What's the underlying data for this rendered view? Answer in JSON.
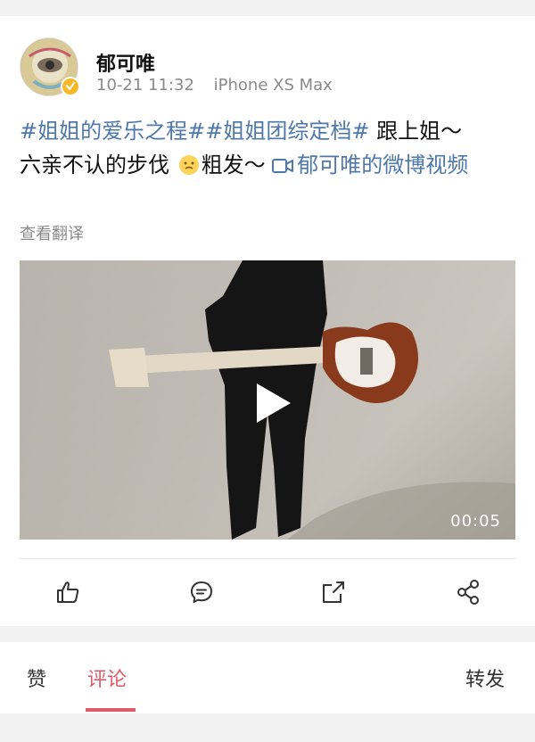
{
  "post": {
    "author": "郁可唯",
    "timestamp": "10-21 11:32",
    "source": "iPhone XS Max",
    "text": {
      "hashtag1": "#姐姐的爱乐之程#",
      "hashtag2": "#姐姐团综定档#",
      "text1": " 跟上姐～",
      "text2": "六亲不认的步伐 ",
      "text3": "粗发～ ",
      "video_link": "郁可唯的微博视频"
    },
    "translate_label": "查看翻译",
    "video": {
      "duration": "00:05"
    }
  },
  "actions": {
    "like_icon": "thumbs-up-icon",
    "comment_icon": "comment-icon",
    "repost_icon": "repost-icon",
    "share_icon": "share-icon"
  },
  "tabs": {
    "like": "赞",
    "comments": "评论",
    "reposts": "转发"
  },
  "colors": {
    "accent": "#e05a6a",
    "link": "#4e78aa",
    "verified": "#f6b824"
  }
}
